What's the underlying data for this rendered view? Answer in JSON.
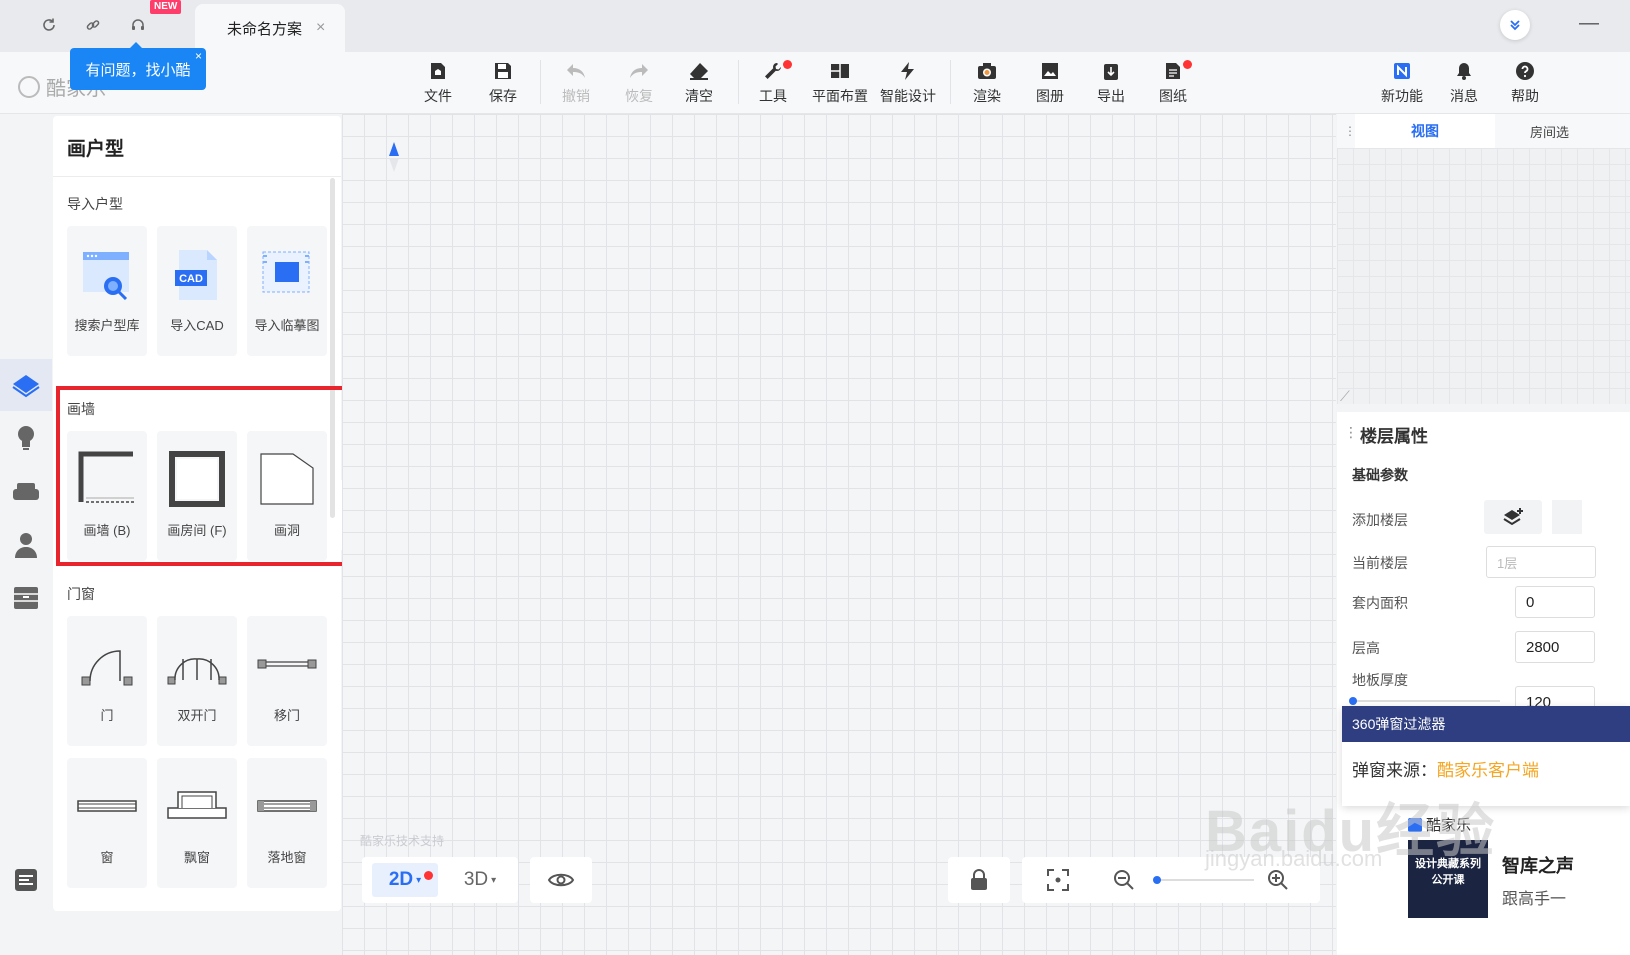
{
  "tabbar": {
    "new_badge": "NEW",
    "document_tab": "未命名方案",
    "close_glyph": "×"
  },
  "tooltip": {
    "text": "有问题，找小酷",
    "close_glyph": "×"
  },
  "logo": {
    "text": "酷家乐"
  },
  "toolbar": {
    "file": "文件",
    "save": "保存",
    "undo": "撤销",
    "redo": "恢复",
    "clear": "清空",
    "tools": "工具",
    "floorplan_layout": "平面布置",
    "smart_design": "智能设计",
    "render": "渲染",
    "album": "图册",
    "export": "导出",
    "drawings": "图纸",
    "new_features": "新功能",
    "messages": "消息",
    "help": "帮助"
  },
  "panel": {
    "title": "画户型",
    "import_section": "导入户型",
    "import_items": [
      {
        "label": "搜索户型库",
        "icon": "search-floorplan-icon"
      },
      {
        "label": "导入CAD",
        "icon": "cad-file-icon",
        "badge": "CAD"
      },
      {
        "label": "导入临摹图",
        "icon": "trace-image-icon"
      }
    ],
    "wall_section": "画墙",
    "wall_items": [
      {
        "label": "画墙 (B)",
        "icon": "draw-wall-icon"
      },
      {
        "label": "画房间 (F)",
        "icon": "draw-room-icon"
      },
      {
        "label": "画洞",
        "icon": "draw-opening-icon"
      }
    ],
    "door_section": "门窗",
    "door_items": [
      {
        "label": "门",
        "icon": "door-icon"
      },
      {
        "label": "双开门",
        "icon": "double-door-icon"
      },
      {
        "label": "移门",
        "icon": "sliding-door-icon"
      },
      {
        "label": "窗",
        "icon": "window-icon"
      },
      {
        "label": "飘窗",
        "icon": "bay-window-icon"
      },
      {
        "label": "落地窗",
        "icon": "french-window-icon"
      }
    ]
  },
  "canvas": {
    "support_text": "酷家乐技术支持",
    "mode_2d": "2D",
    "mode_3d": "3D"
  },
  "right": {
    "tab_view": "视图",
    "tab_room": "房间选",
    "props_title": "楼层属性",
    "props_sub": "基础参数",
    "add_floor": "添加楼层",
    "current_floor": "当前楼层",
    "current_floor_value": "1层",
    "inner_area": "套内面积",
    "inner_area_value": "0",
    "floor_height": "层高",
    "floor_height_value": "2800",
    "slab_thickness": "地板厚度",
    "slab_thickness_value": "120"
  },
  "popup": {
    "header": "360弹窗过滤器",
    "source_label": "弹窗来源：",
    "source_value": "酷家乐客户端"
  },
  "ad": {
    "tag": "酷家乐",
    "image_text": "设计典藏系列公开课",
    "title": "智库之声",
    "desc": "跟高手一"
  },
  "watermark": {
    "brand": "Baidu经验",
    "url": "jingyan.baidu.com"
  },
  "colors": {
    "accent": "#2a6ef3",
    "highlight_box": "#e8242c",
    "tooltip": "#1a86f5",
    "popup_header": "#2f3e80",
    "popup_source": "#f5a623"
  }
}
